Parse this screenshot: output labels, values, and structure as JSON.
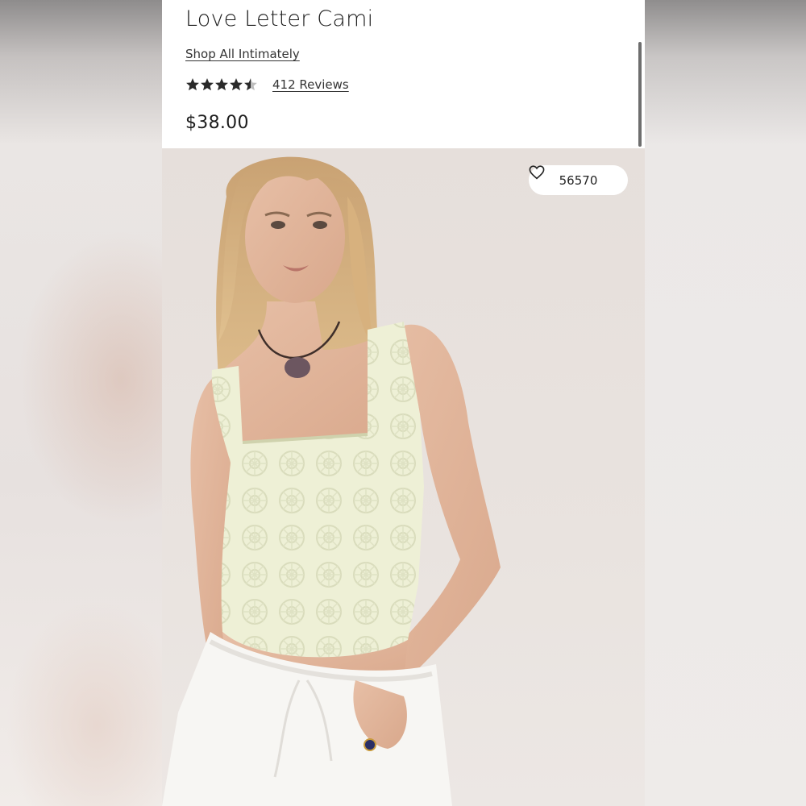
{
  "product": {
    "title": "Love Letter Cami",
    "shop_link": "Shop All Intimately",
    "rating": 4.5,
    "rating_max": 5,
    "reviews_link": "412 Reviews",
    "price": "$38.00"
  },
  "image": {
    "favorites_count": "56570",
    "favorite_icon": "heart-outline-icon"
  },
  "colors": {
    "text": "#1d1d1d",
    "star": "#2a2a2a"
  }
}
